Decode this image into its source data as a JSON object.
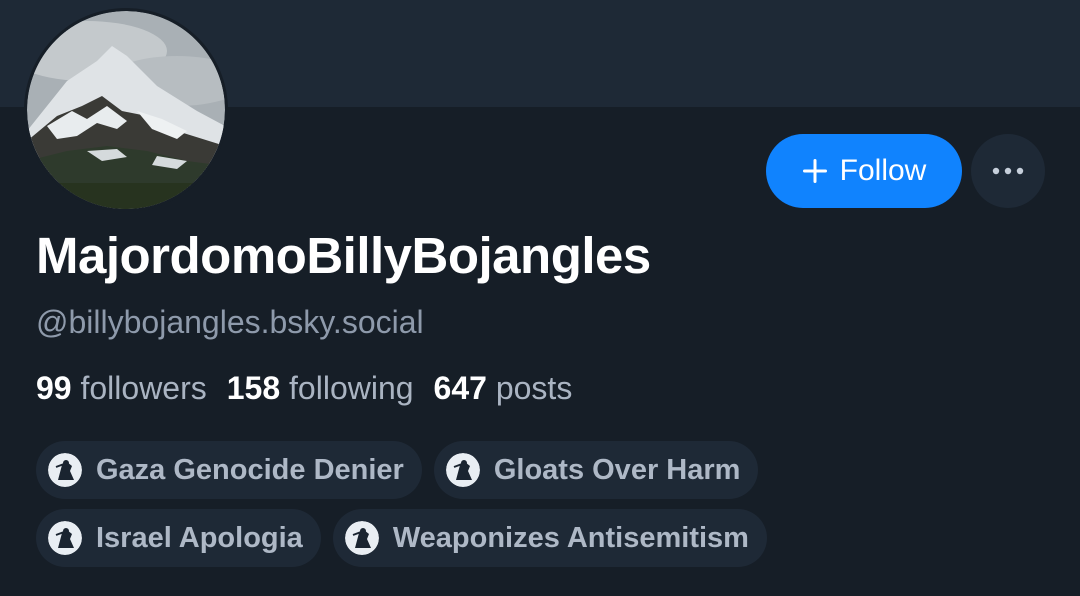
{
  "profile": {
    "display_name": "MajordomoBillyBojangles",
    "handle": "@billybojangles.bsky.social",
    "avatar": "mountain-avatar-icon"
  },
  "actions": {
    "follow_label": "Follow",
    "follow_icon": "plus-icon",
    "more_icon": "ellipsis-icon"
  },
  "stats": [
    {
      "value": "99",
      "label": "followers"
    },
    {
      "value": "158",
      "label": "following"
    },
    {
      "value": "647",
      "label": "posts"
    }
  ],
  "labels": [
    {
      "text": "Gaza Genocide Denier",
      "icon": "labeler-icon"
    },
    {
      "text": "Gloats Over Harm",
      "icon": "labeler-icon"
    },
    {
      "text": "Israel Apologia",
      "icon": "labeler-icon"
    },
    {
      "text": "Weaponizes Antisemitism",
      "icon": "labeler-icon"
    }
  ],
  "colors": {
    "background": "#161e27",
    "banner": "#1e2936",
    "accent": "#1083fe",
    "text_primary": "#ffffff",
    "text_secondary": "#8e9aab"
  }
}
